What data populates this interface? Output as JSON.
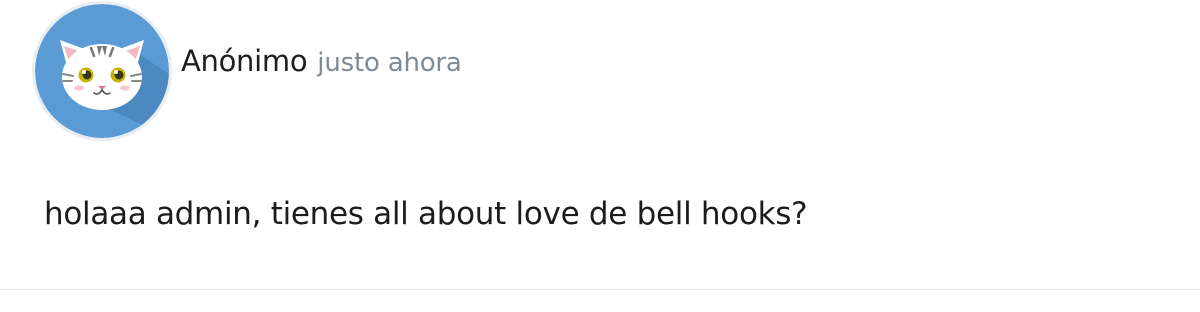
{
  "comment": {
    "avatar_icon": "cat-face-icon",
    "author": "Anónimo",
    "timestamp": "justo ahora",
    "message": "holaaa admin, tienes all about love de bell hooks?"
  },
  "colors": {
    "avatar_background": "#5b9bd5",
    "avatar_shadow": "#4a87bf",
    "timestamp_text": "#7d8a98",
    "divider": "#e6e9ee"
  }
}
